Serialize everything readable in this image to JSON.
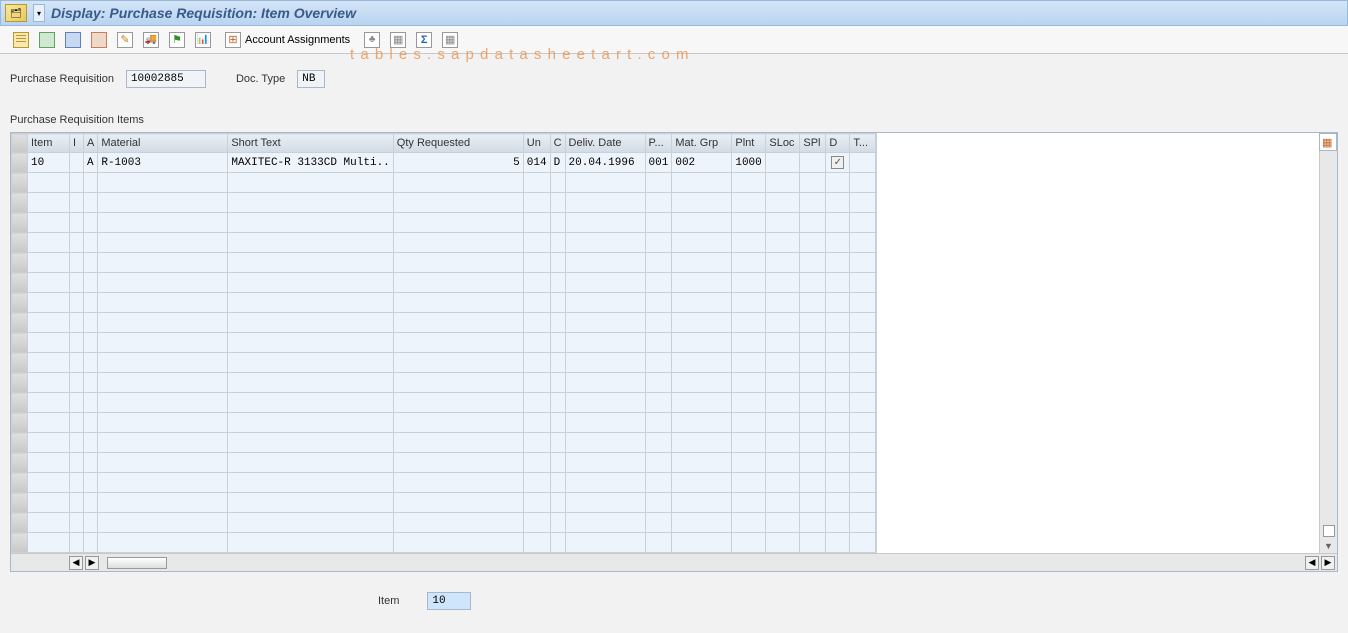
{
  "titlebar": {
    "title": "Display: Purchase Requisition: Item Overview"
  },
  "toolbar": {
    "account_assignments_label": "Account Assignments"
  },
  "header": {
    "pr_label": "Purchase Requisition",
    "pr_value": "10002885",
    "doctype_label": "Doc. Type",
    "doctype_value": "NB"
  },
  "section": {
    "items_label": "Purchase Requisition Items"
  },
  "table": {
    "columns": [
      "Item",
      "I",
      "A",
      "Material",
      "Short Text",
      "Qty Requested",
      "Un",
      "C",
      "Deliv. Date",
      "P...",
      "Mat. Grp",
      "Plnt",
      "SLoc",
      "SPl",
      "D",
      "T..."
    ],
    "rows": [
      {
        "item": "10",
        "i": "",
        "a": "A",
        "material": "R-1003",
        "short_text": "MAXITEC-R 3133CD Multi..",
        "qty": "5",
        "un": "014",
        "c": "D",
        "deliv_date": "20.04.1996",
        "p": "001",
        "mat_grp": "002",
        "plnt": "1000",
        "sloc": "",
        "spl": "",
        "d_checked": true,
        "t": ""
      }
    ]
  },
  "footer": {
    "item_label": "Item",
    "item_value": "10"
  },
  "watermark": "t a b l e s . s a p d a t a s h e e t a r t . c o m"
}
